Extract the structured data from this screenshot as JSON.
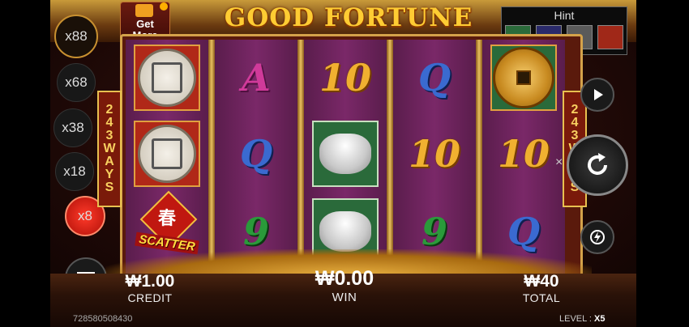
{
  "game": {
    "title": "GOOD FORTUNE",
    "ways_label": [
      "2",
      "4",
      "3",
      "W",
      "A",
      "Y",
      "S"
    ],
    "get_more": [
      "Get",
      "More"
    ]
  },
  "multipliers": [
    "x88",
    "x68",
    "x38",
    "x18",
    "x8"
  ],
  "active_multiplier": "x8",
  "hint": {
    "label": "Hint",
    "icons": [
      "ingot-icon",
      "fan-icon",
      "fan-icon",
      "coin-icon"
    ]
  },
  "reels": [
    [
      "coin-symbol",
      "coin-symbol",
      "scatter-symbol"
    ],
    [
      "A",
      "Q",
      "9"
    ],
    [
      "10",
      "ingot-symbol",
      "ingot-symbol"
    ],
    [
      "Q",
      "10",
      "9"
    ],
    [
      "gold-coin-symbol",
      "10",
      "Q"
    ]
  ],
  "scatter": {
    "label": "SCATTER",
    "badge": "春"
  },
  "bottom": {
    "credit_value": "₩1.00",
    "credit_label": "CREDIT",
    "win_value": "₩0.00",
    "win_label": "WIN",
    "total_value": "₩40",
    "total_label": "TOTAL",
    "round_id": "728580508430",
    "level_label": "LEVEL : ",
    "level_value": "X5"
  },
  "buttons": {
    "spin_side_mark": "×"
  },
  "colors": {
    "active_multiplier": "#e8201a",
    "title": "#ffcc33",
    "frame_gold": "#d4a24a"
  }
}
